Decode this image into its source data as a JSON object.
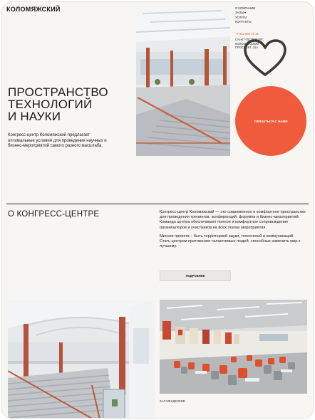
{
  "header": {
    "logo": "КОЛОМЯЖСКИЙ",
    "nav": [
      "О КОМПАНИИ",
      "ЗАЛЫ ▾",
      "УСЛУГИ",
      "КОНТАКТЫ"
    ],
    "phone": "+7 812 604 70 15",
    "address": "САНКТ-ПЕТЕРБУРГ, КОЛОМЯЖСКИЙ ПРОСПЕКТ, 21А"
  },
  "hero": {
    "title_lines": [
      "ПРОСТРАНСТВО",
      "ТЕХНОЛОГИЙ",
      "И НАУКИ"
    ],
    "subtitle": "Конгресс-центр Коломяжский предлагает оптимальные условия для проведения научных и бизнес-мероприятий самого разного масштаба.",
    "cta_label": "СВЯЗАТЬСЯ С НАМИ"
  },
  "about": {
    "title": "О КОНГРЕСС-ЦЕНТРЕ",
    "paragraph1": "Конгресс-центр Коломяжский — это современное и комфортное пространство для проведения тренингов, конференций, форумов и бизнес-мероприятий. Команда центра обеспечивает полное и комфортное сопровождение организаторов и участников на всех этапах мероприятия.",
    "paragraph2": "Миссия проекта – быть территорией науки, технологий и коммуникаций. Стать центром притяжения талантливых людей, способных изменить мир к лучшему.",
    "more_label": "ПОДРОБНЕЕ"
  },
  "gallery": {
    "hall_caption": "ЗАЛ МЕНДЕЛЕЕВ"
  },
  "colors": {
    "accent": "#ef5b3c",
    "background": "#f7f6f3"
  },
  "icons": {
    "favorite": "heart-icon"
  }
}
